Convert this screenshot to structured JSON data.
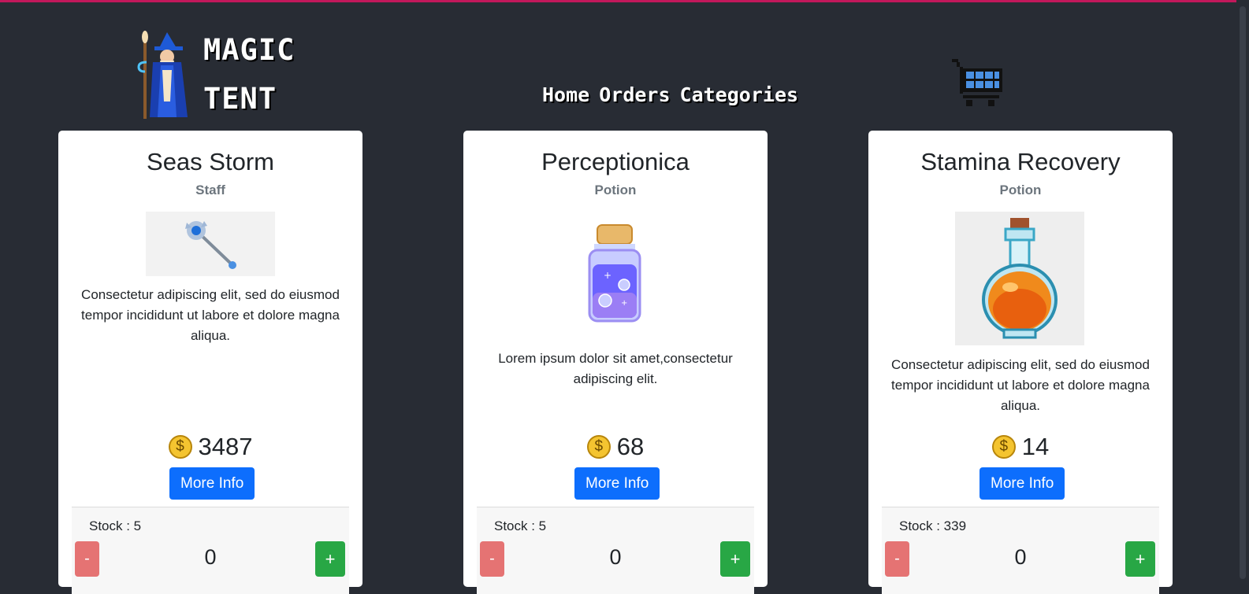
{
  "header": {
    "logo_line1": "MAGIC",
    "logo_line2": "TENT",
    "nav": [
      "Home",
      "Orders",
      "Categories"
    ]
  },
  "colors": {
    "background": "#282c34",
    "info_button": "#0d6efd",
    "plus_button": "#28a745",
    "minus_button": "#e57373",
    "coin": "#f4c430"
  },
  "icons": {
    "logo": "wizard-icon",
    "cart": "shopping-cart-icon",
    "price": "gold-coin-icon"
  },
  "products": [
    {
      "name": "Seas Storm",
      "category": "Staff",
      "image": "staff-icon",
      "description": "Consectetur adipiscing elit, sed do eiusmod tempor incididunt ut labore et dolore magna aliqua.",
      "price": "3487",
      "info_label": "More Info",
      "stock": "Stock : 5",
      "quantity": "0",
      "minus_label": "-",
      "plus_label": "+"
    },
    {
      "name": "Perceptionica",
      "category": "Potion",
      "image": "purple-potion-icon",
      "description": "Lorem ipsum dolor sit amet,consectetur adipiscing elit.",
      "price": "68",
      "info_label": "More Info",
      "stock": "Stock : 5",
      "quantity": "0",
      "minus_label": "-",
      "plus_label": "+"
    },
    {
      "name": "Stamina Recovery",
      "category": "Potion",
      "image": "orange-potion-icon",
      "description": "Consectetur adipiscing elit, sed do eiusmod tempor incididunt ut labore et dolore magna aliqua.",
      "price": "14",
      "info_label": "More Info",
      "stock": "Stock : 339",
      "quantity": "0",
      "minus_label": "-",
      "plus_label": "+"
    }
  ]
}
